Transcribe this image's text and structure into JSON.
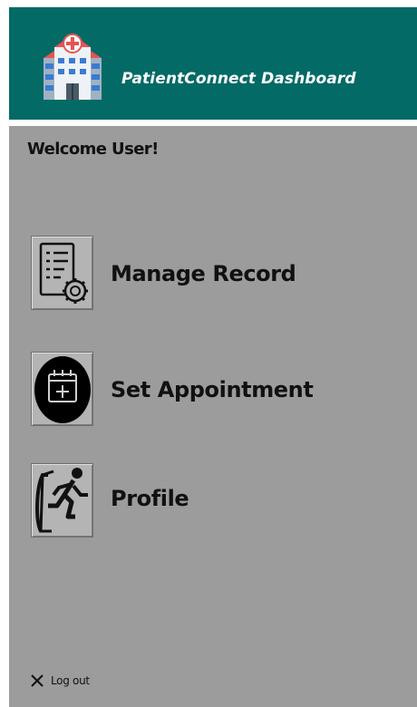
{
  "header": {
    "title": "PatientConnect Dashboard",
    "logo_icon": "hospital-icon",
    "background": "#036a66"
  },
  "main": {
    "welcome": "Welcome User!",
    "background": "#9c9c9c",
    "menu": [
      {
        "label": "Manage Record",
        "icon": "document-gear-icon"
      },
      {
        "label": "Set Appointment",
        "icon": "calendar-plus-icon"
      },
      {
        "label": "Profile",
        "icon": "exit-door-icon"
      }
    ]
  },
  "footer": {
    "logout_label": "Log out",
    "logout_icon": "close-icon"
  }
}
